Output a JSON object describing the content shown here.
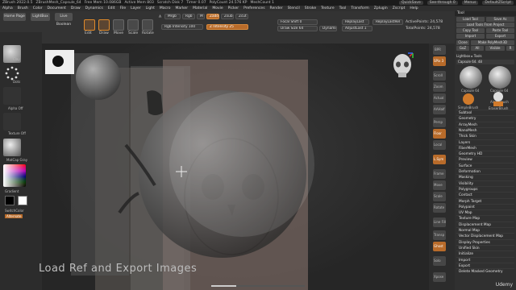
{
  "titlebar": {
    "app": "ZBrush 2022.0.5",
    "doc": "ZBrushMesh_Capsule_64",
    "free_mem": "Free Mem 10.086GB",
    "active_mem": "Active Mem 803",
    "scratch": "Scratch Disk 7",
    "timer": "Timer 0.07",
    "polycount": "PolyCount 24.576 KP",
    "meshcount": "MeshCount 1",
    "quicksave": "QuickSave",
    "seethrough": "See-through 0",
    "menus": "Menus",
    "script": "DefaultZScript"
  },
  "menubar": [
    "Alpha",
    "Brush",
    "Color",
    "Document",
    "Draw",
    "Dynamics",
    "Edit",
    "File",
    "Layer",
    "Light",
    "Macro",
    "Marker",
    "Material",
    "Movie",
    "Picker",
    "Preferences",
    "Render",
    "Stencil",
    "Stroke",
    "Texture",
    "Tool",
    "Transform",
    "Zplugin",
    "Zscript",
    "Help"
  ],
  "shelf": {
    "home": "Home Page",
    "lightbox": "LightBox",
    "live_boolean": "Live Boolean",
    "edit": "Edit",
    "draw": "Draw",
    "move": "Move",
    "scale": "Scale",
    "rotate": "Rotate",
    "a_label": "A",
    "mrgb": "Mrgb",
    "rgb": "Rgb",
    "m": "M",
    "zadd": "Zadd",
    "zsub": "Zsub",
    "zcut": "Zcut",
    "rgb_intensity": "Rgb Intensity 100",
    "z_intensity": "Z Intensity 25",
    "focal_shift": "Focal Shift 0",
    "draw_size": "Draw Size 64",
    "dynamic": "Dynamic",
    "replay_last": "ReplayLast",
    "replay_last_rel": "ReplayLastRel",
    "adjust_last": "AdjustLast 1",
    "active_points": "ActivePoints: 24,578",
    "total_points": "TotalPoints: 24,578"
  },
  "left": {
    "clay": "Clay",
    "dots": "Dots",
    "alpha": "Alpha Off",
    "texture": "Texture Off",
    "matcap": "MatCap Gray",
    "gradient": "Gradient",
    "switch_color": "SwitchColor",
    "alternate": "Alternate"
  },
  "tool_panel": {
    "title": "Tool",
    "load_tool": "Load Tool",
    "save_as": "Save As",
    "load_from_project": "Load Tools From Project",
    "copy_tool": "Copy Tool",
    "paste_tool": "Paste Tool",
    "import": "Import",
    "export": "Export",
    "clone": "Clone",
    "make_polymesh": "Make PolyMesh3D",
    "goz": "GoZ",
    "all": "All",
    "visible": "Visible",
    "r": "R",
    "lightbox_tools": "Lightbox ▸ Tools",
    "capsule_label": "Capsule 64. 48",
    "thumb1": "Capsule 64",
    "thumb2": "Capsule 64",
    "thumb3": "SimpleBrush",
    "thumb4": "AlphaBrush",
    "thumb5": "EraserBrush",
    "items": [
      "Subtool",
      "Geometry",
      "ArrayMesh",
      "NanoMesh",
      "Thick Skin",
      "Layers",
      "FiberMesh",
      "Geometry HD",
      "Preview",
      "Surface",
      "Deformation",
      "Masking",
      "Visibility",
      "Polygroups",
      "Contact",
      "Morph Target",
      "Polypaint",
      "UV Map",
      "Texture Map",
      "Displacement Map",
      "Normal Map",
      "Vector Displacement Map",
      "Display Properties",
      "Unified Skin",
      "Initialize",
      "Import",
      "Export",
      "Delete Masked Geometry"
    ]
  },
  "right_bar": [
    "BPR",
    "SPix 3",
    "Scroll",
    "Zoom",
    "Actual",
    "AAHalf",
    "Persp",
    "Floor",
    "Local",
    "L.Sym",
    "Frame",
    "Move",
    "Scale",
    "Rotate",
    "Line Fill",
    "Transp",
    "Ghost",
    "Solo",
    "Xpose"
  ],
  "canvas": {
    "caption": "Load Ref and Export Images",
    "watermark": "Udemy",
    "progress": 0.27
  },
  "colors": {
    "accent": "#e08a2b",
    "bg": "#2a2a2a",
    "panel": "#303030"
  }
}
